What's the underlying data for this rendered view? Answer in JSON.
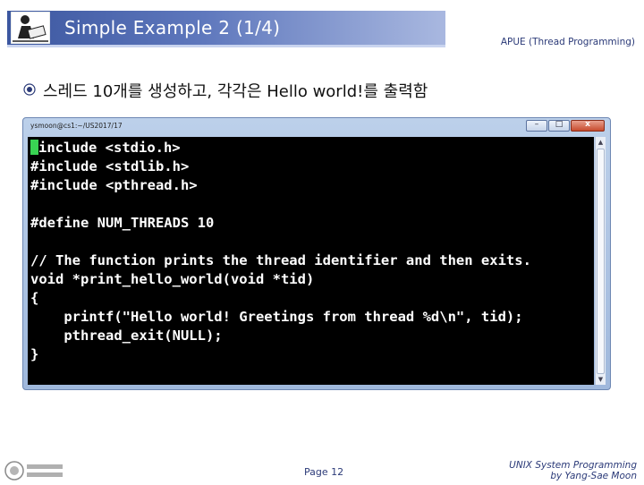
{
  "slide": {
    "title": "Simple Example 2 (1/4)",
    "header_right": "APUE (Thread Programming)",
    "bullet": "스레드 10개를 생성하고, 각각은 Hello world!를 출력함",
    "page": "Page 12",
    "footer_line1": "UNIX System Programming",
    "footer_line2": "by Yang-Sae Moon"
  },
  "terminal": {
    "title": "ysmoon@cs1:~/US2017/17",
    "buttons": {
      "minimize": "–",
      "maximize": "□",
      "close": "x"
    },
    "cursor_color": "#39d353",
    "lines": [
      "include <stdio.h>",
      "#include <stdlib.h>",
      "#include <pthread.h>",
      "",
      "#define NUM_THREADS 10",
      "",
      "// The function prints the thread identifier and then exits.",
      "void *print_hello_world(void *tid)",
      "{",
      "    printf(\"Hello world! Greetings from thread %d\\n\", tid);",
      "    pthread_exit(NULL);",
      "}"
    ]
  },
  "colors": {
    "title_band": "#3c57a0",
    "header_text": "#2b3a78",
    "terminal_bg": "#000000"
  }
}
